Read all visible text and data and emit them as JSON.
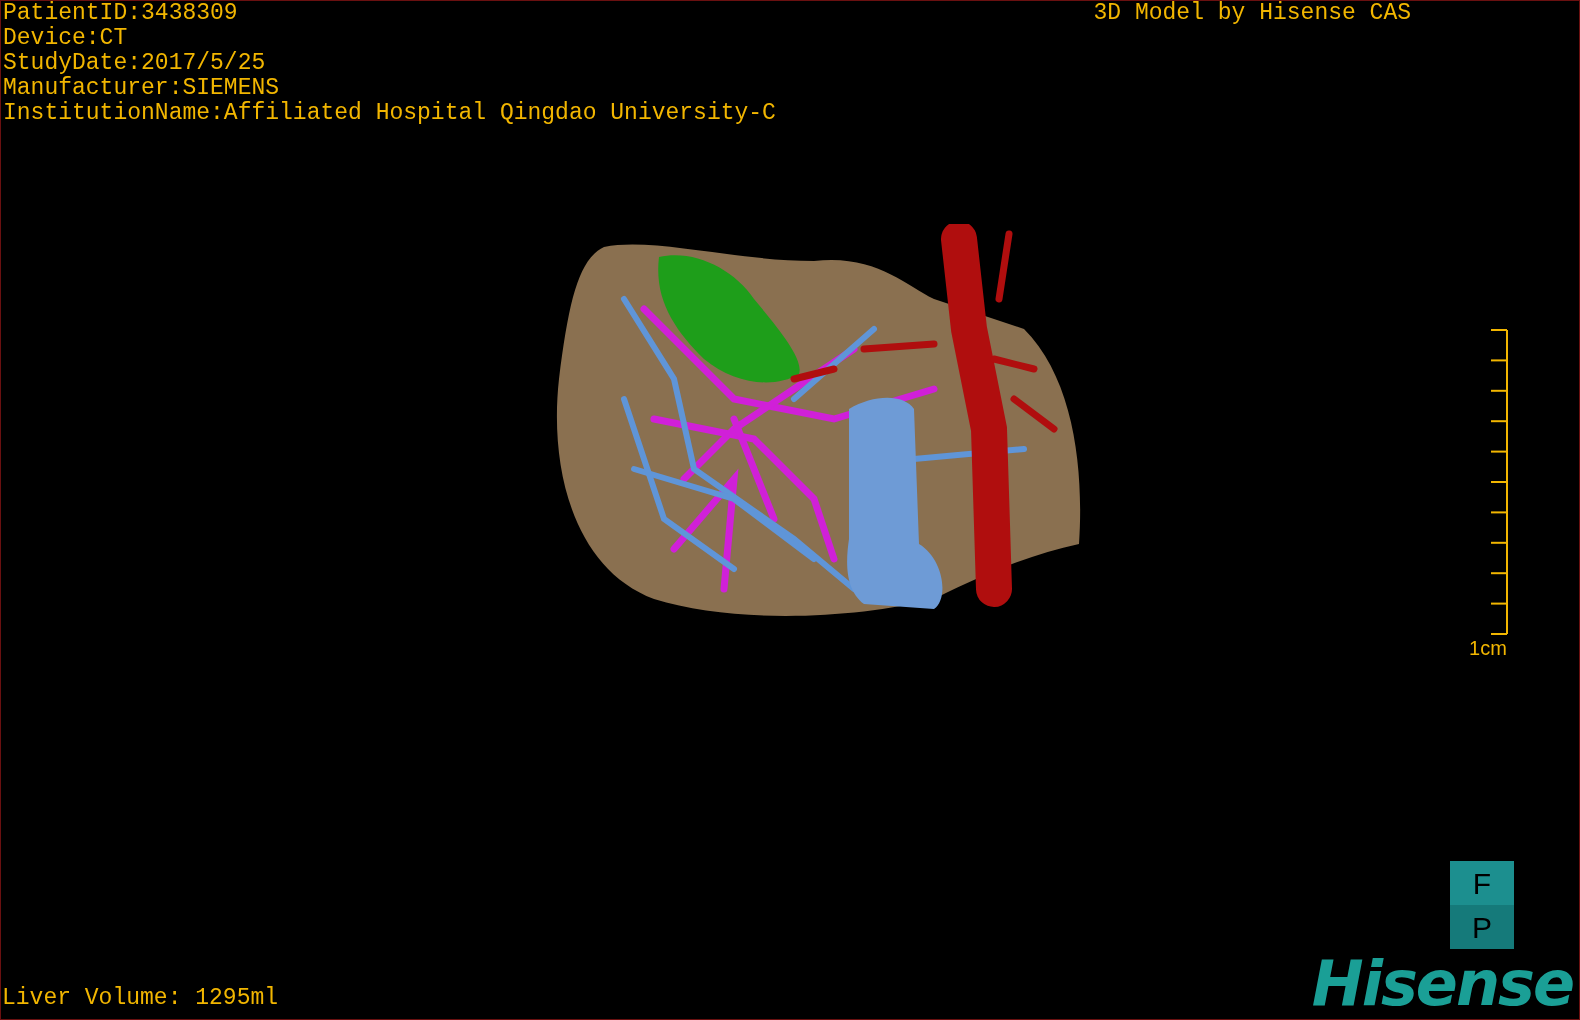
{
  "patient_info": [
    "PatientID:3438309",
    "Device:CT",
    "StudyDate:2017/5/25",
    "Manufacturer:SIEMENS",
    "InstitutionName:Affiliated Hospital Qingdao University-C"
  ],
  "title": "3D Model by Hisense CAS",
  "scale_bar": {
    "label": "1cm"
  },
  "liver_volume": "Liver Volume: 1295ml",
  "orientation_cube": [
    "F",
    "P"
  ],
  "logo": "Hisense"
}
